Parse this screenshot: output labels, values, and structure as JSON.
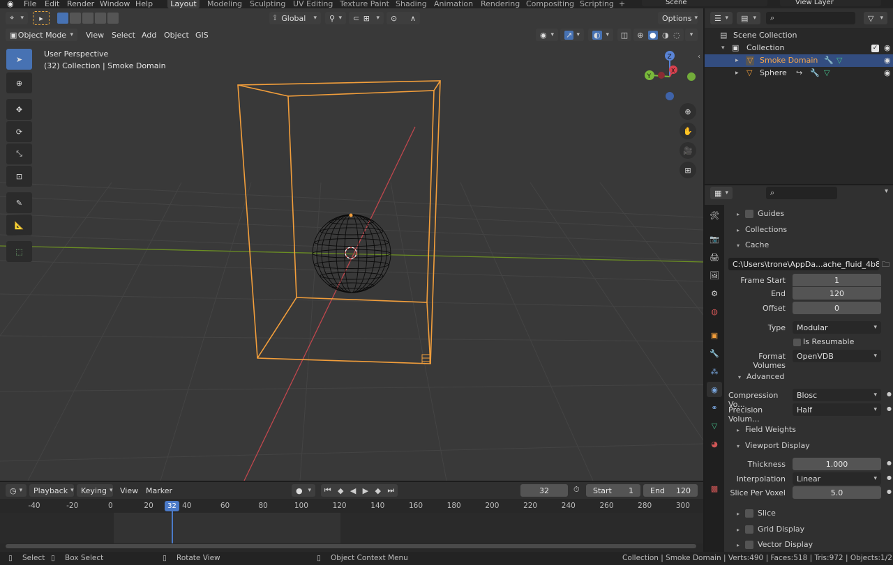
{
  "topbar": {
    "menus": [
      "File",
      "Edit",
      "Render",
      "Window",
      "Help"
    ],
    "workspaces": [
      "Layout",
      "Modeling",
      "Sculpting",
      "UV Editing",
      "Texture Paint",
      "Shading",
      "Animation",
      "Rendering",
      "Compositing",
      "Scripting"
    ],
    "active_workspace": "Layout",
    "scene": "Scene",
    "view_layer": "View Layer"
  },
  "viewport_header": {
    "mode": "Object Mode",
    "menus": [
      "View",
      "Select",
      "Add",
      "Object",
      "GIS"
    ],
    "transform_orientation": "Global",
    "options": "Options"
  },
  "viewport": {
    "perspective": "User Perspective",
    "context": "(32) Collection | Smoke Domain",
    "gizmo_axes": {
      "x": "X",
      "y": "Y",
      "z": "Z"
    }
  },
  "outliner": {
    "search_placeholder": "",
    "root": "Scene Collection",
    "collection": "Collection",
    "items": [
      {
        "name": "Smoke Domain",
        "selected": true
      },
      {
        "name": "Sphere",
        "selected": false
      }
    ]
  },
  "properties": {
    "sections": {
      "guides": "Guides",
      "collections": "Collections",
      "cache": "Cache",
      "advanced": "Advanced",
      "field_weights": "Field Weights",
      "viewport_display": "Viewport Display",
      "slice": "Slice",
      "grid_display": "Grid Display",
      "vector_display": "Vector Display"
    },
    "cache_path": "C:\\Users\\trone\\AppDa...ache_fluid_4b85f272",
    "frame_start_label": "Frame Start",
    "frame_start": "1",
    "end_label": "End",
    "end": "120",
    "offset_label": "Offset",
    "offset": "0",
    "type_label": "Type",
    "type": "Modular",
    "is_resumable": "Is Resumable",
    "format_volumes_label": "Format Volumes",
    "format_volumes": "OpenVDB",
    "compression_label": "Compression Vo...",
    "compression": "Blosc",
    "precision_label": "Precision Volum...",
    "precision": "Half",
    "thickness_label": "Thickness",
    "thickness": "1.000",
    "interpolation_label": "Interpolation",
    "interpolation": "Linear",
    "slice_per_voxel_label": "Slice Per Voxel",
    "slice_per_voxel": "5.0"
  },
  "timeline": {
    "menus": [
      "Playback",
      "Keying",
      "View",
      "Marker"
    ],
    "current_frame": "32",
    "start_label": "Start",
    "start": "1",
    "end_label": "End",
    "end": "120",
    "ruler": [
      "-40",
      "-20",
      "0",
      "20",
      "40",
      "60",
      "80",
      "100",
      "120",
      "140",
      "160",
      "180",
      "200",
      "220",
      "240",
      "260",
      "280",
      "300"
    ]
  },
  "statusbar": {
    "select": "Select",
    "box_select": "Box Select",
    "rotate_view": "Rotate View",
    "context_menu": "Object Context Menu",
    "stats": "Collection | Smoke Domain | Verts:490 | Faces:518 | Tris:972 | Objects:1/2 | 2.92.0"
  },
  "colors": {
    "accent": "#4772b3",
    "selection_orange": "#f29e3b",
    "active_frame": "#4b7ac8"
  }
}
